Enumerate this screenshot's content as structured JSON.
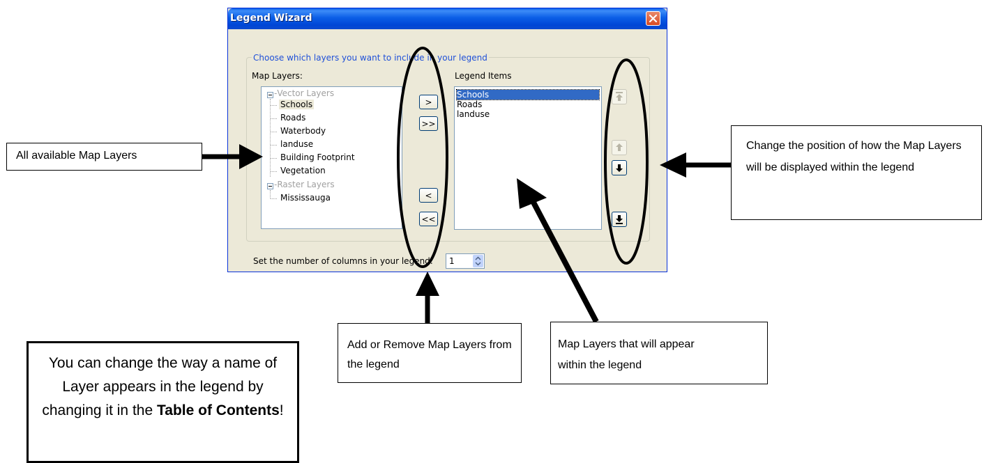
{
  "dialog": {
    "title": "Legend Wizard",
    "close_icon": "close-icon",
    "group_label": "Choose which layers you want to include in your legend",
    "map_layers_label": "Map Layers:",
    "legend_items_label": "Legend Items",
    "tree": {
      "vector_group": "Vector Layers",
      "vector_layers": [
        "Schools",
        "Roads",
        "Waterbody",
        "landuse",
        "Building Footprint",
        "Vegetation"
      ],
      "raster_group": "Raster Layers",
      "raster_layers": [
        "Mississauga"
      ],
      "selected": "Schools"
    },
    "legend_items": [
      "Schools",
      "Roads",
      "landuse"
    ],
    "selected_legend_item": "Schools",
    "buttons": {
      "add": ">",
      "add_all": ">>",
      "remove": "<",
      "remove_all": "<<"
    },
    "order_buttons": [
      "move-top-icon",
      "move-up-icon",
      "move-down-icon",
      "move-bottom-icon"
    ],
    "columns_label": "Set the number of columns in your legend:",
    "columns_value": "1"
  },
  "callouts": {
    "map_layers": "All available Map Layers",
    "reorder": "Change the position of how the Map Layers will be displayed within the legend",
    "add_remove": "Add or Remove Map Layers from the legend",
    "legend_layers": "Map Layers that will appear within the legend",
    "tip_prefix": "You can change the way a name of Layer appears in the legend by changing it in the",
    "tip_bold": "Table of Contents",
    "tip_suffix": "!"
  },
  "colors": {
    "titlebar": "#0054e3",
    "selection": "#316ac5",
    "group_text": "#1f50d8",
    "dialog_bg": "#ece9d8"
  }
}
